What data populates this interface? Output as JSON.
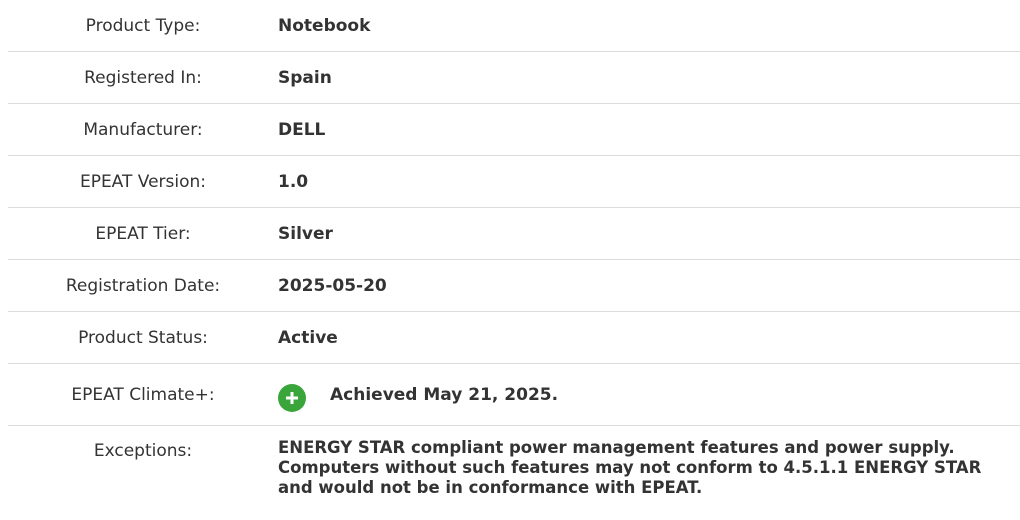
{
  "details": [
    {
      "label": "Product Type:",
      "value": "Notebook"
    },
    {
      "label": "Registered In:",
      "value": "Spain"
    },
    {
      "label": "Manufacturer:",
      "value": "DELL"
    },
    {
      "label": "EPEAT Version:",
      "value": "1.0"
    },
    {
      "label": "EPEAT Tier:",
      "value": "Silver"
    },
    {
      "label": "Registration Date:",
      "value": "2025-05-20"
    },
    {
      "label": "Product Status:",
      "value": "Active"
    },
    {
      "label": "EPEAT Climate+:",
      "value": "Achieved May 21, 2025.",
      "icon": "plus-circle-icon",
      "icon_color": "#3aa53a"
    },
    {
      "label": "Exceptions:",
      "value": "ENERGY STAR compliant power management features and power supply. Computers without such features may not conform to 4.5.1.1 ENERGY STAR and would not be in conformance with EPEAT."
    }
  ]
}
